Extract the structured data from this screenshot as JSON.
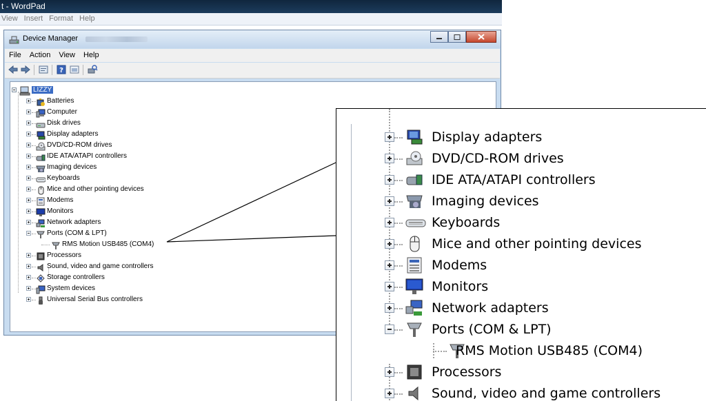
{
  "wordpad": {
    "title": "t - WordPad",
    "menu": [
      "View",
      "Insert",
      "Format",
      "Help"
    ]
  },
  "device_manager": {
    "title": "Device Manager",
    "menu": [
      "File",
      "Action",
      "View",
      "Help"
    ],
    "toolbar_icons": [
      "back-icon",
      "forward-icon",
      "properties-icon",
      "help-icon",
      "show-hidden-icon",
      "scan-hardware-icon"
    ],
    "root": "LIZZY",
    "categories": [
      {
        "label": "Batteries",
        "icon": "battery-icon"
      },
      {
        "label": "Computer",
        "icon": "computer-icon"
      },
      {
        "label": "Disk drives",
        "icon": "disk-drive-icon"
      },
      {
        "label": "Display adapters",
        "icon": "display-adapter-icon"
      },
      {
        "label": "DVD/CD-ROM drives",
        "icon": "dvd-drive-icon"
      },
      {
        "label": "IDE ATA/ATAPI controllers",
        "icon": "ide-controller-icon"
      },
      {
        "label": "Imaging devices",
        "icon": "camera-icon"
      },
      {
        "label": "Keyboards",
        "icon": "keyboard-icon"
      },
      {
        "label": "Mice and other pointing devices",
        "icon": "mouse-icon"
      },
      {
        "label": "Modems",
        "icon": "modem-icon"
      },
      {
        "label": "Monitors",
        "icon": "monitor-icon"
      },
      {
        "label": "Network adapters",
        "icon": "network-adapter-icon"
      },
      {
        "label": "Ports (COM & LPT)",
        "icon": "port-icon",
        "expanded": true,
        "child": "RMS Motion USB485 (COM4)"
      },
      {
        "label": "Processors",
        "icon": "processor-icon"
      },
      {
        "label": "Sound, video and game controllers",
        "icon": "speaker-icon"
      },
      {
        "label": "Storage controllers",
        "icon": "storage-controller-icon"
      },
      {
        "label": "System devices",
        "icon": "system-device-icon"
      },
      {
        "label": "Universal Serial Bus controllers",
        "icon": "usb-icon"
      }
    ]
  },
  "zoom": {
    "items": [
      {
        "label": "Display adapters",
        "icon": "display-adapter-icon"
      },
      {
        "label": "DVD/CD-ROM drives",
        "icon": "dvd-drive-icon"
      },
      {
        "label": "IDE ATA/ATAPI controllers",
        "icon": "ide-controller-icon"
      },
      {
        "label": "Imaging devices",
        "icon": "camera-icon"
      },
      {
        "label": "Keyboards",
        "icon": "keyboard-icon"
      },
      {
        "label": "Mice and other pointing devices",
        "icon": "mouse-icon"
      },
      {
        "label": "Modems",
        "icon": "modem-icon"
      },
      {
        "label": "Monitors",
        "icon": "monitor-icon"
      },
      {
        "label": "Network adapters",
        "icon": "network-adapter-icon"
      },
      {
        "label": "Ports (COM & LPT)",
        "icon": "port-icon",
        "expanded": true
      },
      {
        "label": "RMS Motion USB485 (COM4)",
        "icon": "port-icon",
        "child": true
      },
      {
        "label": "Processors",
        "icon": "processor-icon"
      },
      {
        "label": "Sound, video and game controllers",
        "icon": "speaker-icon"
      }
    ]
  }
}
